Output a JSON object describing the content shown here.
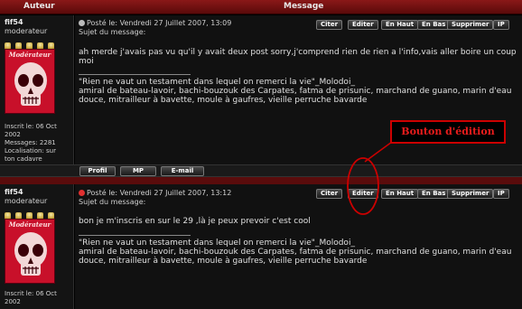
{
  "header": {
    "author_col": "Auteur",
    "message_col": "Message"
  },
  "buttons": {
    "citer": "Citer",
    "editer": "Editer",
    "en_haut": "En Haut",
    "en_bas": "En Bas",
    "supprimer": "Supprimer",
    "ip": "IP"
  },
  "footer_buttons": {
    "profil": "Profil",
    "mp": "MP",
    "email": "E-mail"
  },
  "annotation": {
    "label": "Bouton d'édition",
    "color": "#e81c1c"
  },
  "posts": [
    {
      "username": "fif54",
      "rank": "moderateur",
      "avatar_label": "Modérateur",
      "info": [
        "Inscrit le: 06 Oct",
        "2002",
        "Messages: 2281",
        "Localisation: sur",
        "ton cadavre"
      ],
      "posted": "Posté le: Vendredi 27 Juillet 2007, 13:09",
      "subject": "Sujet du message:",
      "message": "ah merde j'avais pas vu qu'il y avait deux post sorry,j'comprend rien de rien a l'info,vais aller boire un coup moi",
      "sig_line1": "\"Rien ne vaut un testament dans lequel on remerci la vie\"_Molodoi_",
      "sig_line2": "amiral de bateau-lavoir, bachi-bouzouk des Carpates, fatma de prisunic, marchand de guano, marin d'eau douce, mitrailleur à bavette, moule à gaufres, vieille perruche bavarde"
    },
    {
      "username": "fif54",
      "rank": "moderateur",
      "avatar_label": "Modérateur",
      "info": [
        "Inscrit le: 06 Oct",
        "2002"
      ],
      "posted": "Posté le: Vendredi 27 Juillet 2007, 13:12",
      "subject": "Sujet du message:",
      "message": "bon je m'inscris en sur le 29 ,là je peux prevoir c'est cool",
      "sig_line1": "\"Rien ne vaut un testament dans lequel on remerci la vie\"_Molodoi_",
      "sig_line2": "amiral de bateau-lavoir, bachi-bouzouk des Carpates, fatma de prisunic, marchand de guano, marin d'eau douce, mitrailleur à bavette, moule à gaufres, vieille perruche bavarde"
    }
  ]
}
